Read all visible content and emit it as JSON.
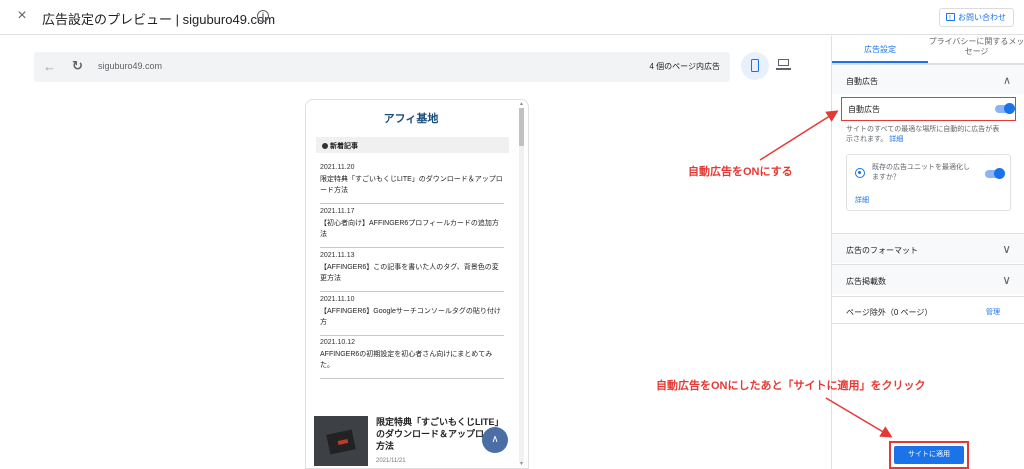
{
  "topbar": {
    "close_icon": "×",
    "title": "広告設定のプレビュー | siguburo49.com",
    "info_icon": "i",
    "contact_label": "お問い合わせ"
  },
  "browser": {
    "url": "siguburo49.com",
    "ad_count": "4 個のページ内広告",
    "back_icon": "←",
    "reload_icon": "↻"
  },
  "site": {
    "name": "アフィ基地",
    "new_posts_header": "新着記事",
    "posts": [
      {
        "date": "2021.11.20",
        "title": "限定特典「すごいもくじLITE」のダウンロード＆アップロード方法"
      },
      {
        "date": "2021.11.17",
        "title": "【初心者向け】AFFINGER6プロフィールカードの追加方法"
      },
      {
        "date": "2021.11.13",
        "title": "【AFFINGER6】この記事を書いた人のタグ、背景色の変更方法"
      },
      {
        "date": "2021.11.10",
        "title": "【AFFINGER6】Googleサーチコンソールタグの貼り付け方"
      },
      {
        "date": "2021.10.12",
        "title": "AFFINGER6の初期設定を初心者さん向けにまとめてみた。"
      }
    ],
    "featured": {
      "title": "限定特典「すごいもくじLITE」のダウンロード＆アップロード方法",
      "date": "2021/11/21"
    },
    "fab_icon": "∧"
  },
  "panel": {
    "tab_ad": "広告設定",
    "tab_privacy": "プライバシーに関するメッセージ",
    "auto_ads_section": "自動広告",
    "auto_ads_toggle_label": "自動広告",
    "auto_ads_on": true,
    "auto_ads_desc": "サイトのすべての最適な場所に自動的に広告が表示されます。",
    "auto_ads_desc_link": "詳細",
    "optimize_text": "既存の広告ユニットを最適化しますか？",
    "optimize_on": true,
    "optimize_link": "詳細",
    "ad_format": "広告のフォーマット",
    "ad_load": "広告掲載数",
    "page_exclusion": "ページ除外（0 ページ）",
    "manage": "管理",
    "apply_button": "サイトに適用"
  },
  "annotations": {
    "turn_on": "自動広告をONにする",
    "click_apply": "自動広告をONにしたあと「サイトに適用」をクリック"
  },
  "colors": {
    "accent": "#1a73e8",
    "annotation": "#e53935"
  }
}
